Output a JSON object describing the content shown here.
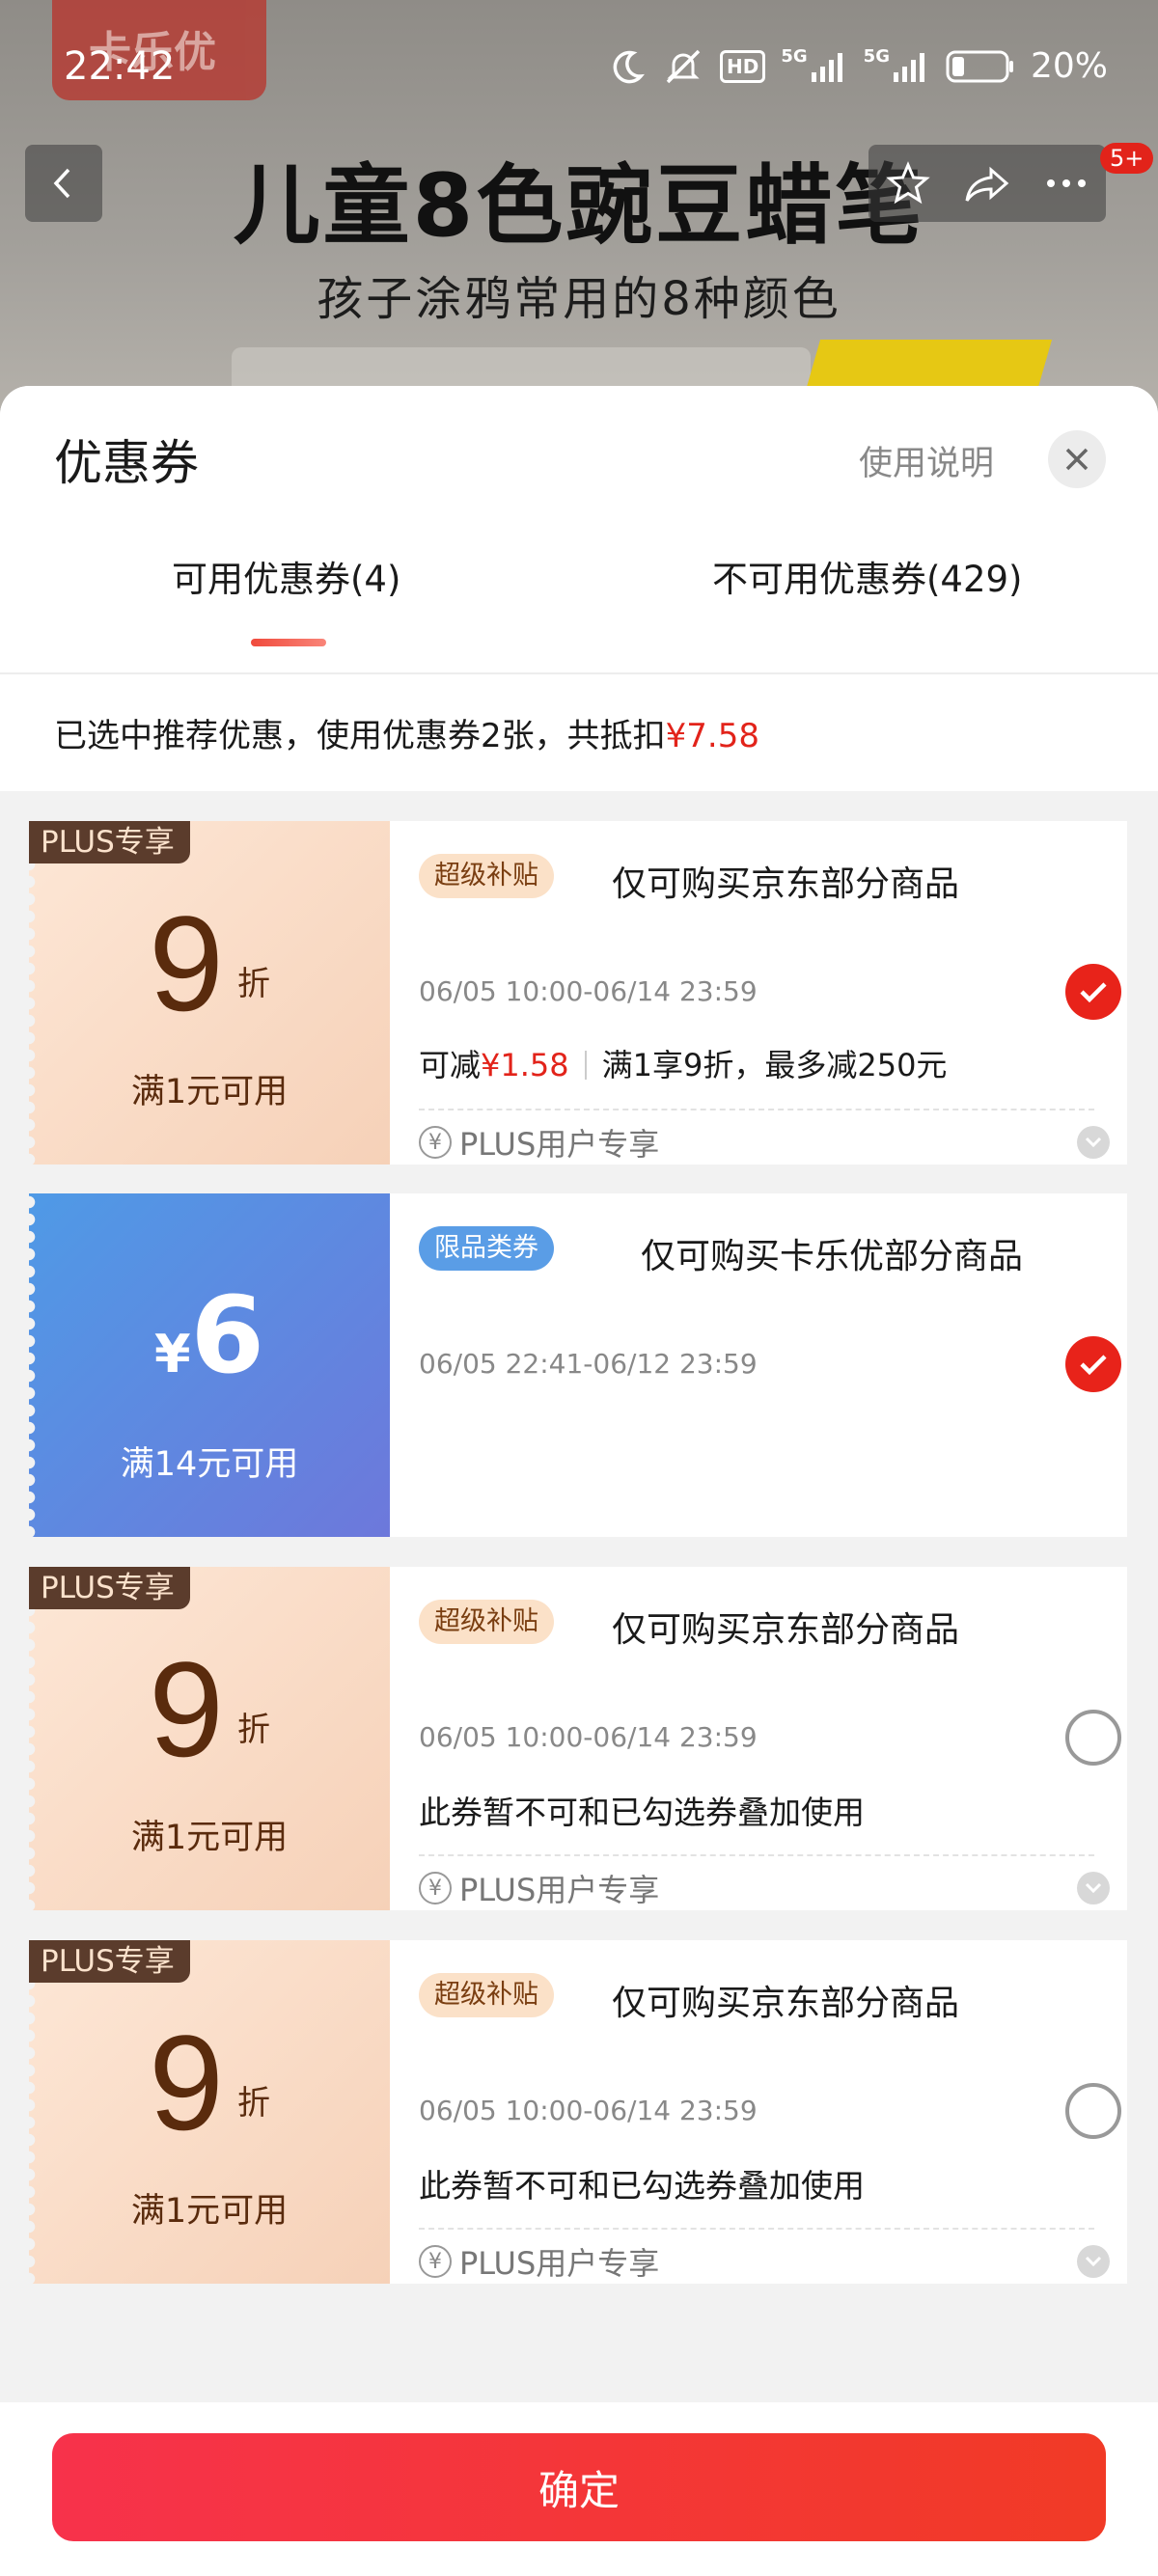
{
  "status_bar": {
    "time": "22:42",
    "hd_label": "HD",
    "network_1": "5G",
    "network_2": "5G",
    "battery": "20%"
  },
  "background": {
    "brand_stamp": "卡乐优",
    "headline": "儿童8色豌豆蜡笔",
    "subline": "孩子涂鸦常用的8种颜色",
    "message_badge": "5+"
  },
  "sheet": {
    "title": "优惠券",
    "help_link": "使用说明",
    "tabs": [
      {
        "label": "可用优惠券(4)",
        "active": true
      },
      {
        "label": "不可用优惠券(429)",
        "active": false
      }
    ],
    "summary_prefix": "已选中推荐优惠，使用优惠券2张，共抵扣",
    "summary_amount": "¥7.58"
  },
  "coupons": [
    {
      "plus_tag": "PLUS专享",
      "value": "9",
      "unit": "折",
      "condition": "满1元可用",
      "tag": "超级补贴",
      "scope": "仅可购买京东部分商品",
      "period": "06/05 10:00-06/14 23:59",
      "saving_prefix": "可减",
      "saving_amount": "¥1.58",
      "saving_rule": "满1享9折，最多减250元",
      "footer": "PLUS用户专享",
      "selected": true
    },
    {
      "currency": "¥",
      "value": "6",
      "condition": "满14元可用",
      "tag": "限品类券",
      "scope": "仅可购买卡乐优部分商品",
      "period": "06/05 22:41-06/12 23:59",
      "selected": true
    },
    {
      "plus_tag": "PLUS专享",
      "value": "9",
      "unit": "折",
      "condition": "满1元可用",
      "tag": "超级补贴",
      "scope": "仅可购买京东部分商品",
      "period": "06/05 10:00-06/14 23:59",
      "note": "此券暂不可和已勾选券叠加使用",
      "footer": "PLUS用户专享",
      "selected": false
    },
    {
      "plus_tag": "PLUS专享",
      "value": "9",
      "unit": "折",
      "condition": "满1元可用",
      "tag": "超级补贴",
      "scope": "仅可购买京东部分商品",
      "period": "06/05 10:00-06/14 23:59",
      "note": "此券暂不可和已勾选券叠加使用",
      "footer": "PLUS用户专享",
      "selected": false
    }
  ],
  "footer": {
    "confirm_label": "确定"
  },
  "colors": {
    "accent_red": "#e2231a",
    "confirm_gradient_start": "#f7324b",
    "confirm_gradient_end": "#f13a26"
  }
}
